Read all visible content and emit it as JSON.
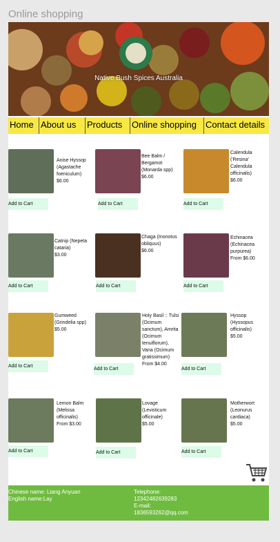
{
  "page_title": "Online shopping",
  "banner": {
    "caption": "Native Bush Spices Australia"
  },
  "nav": [
    {
      "label": "Home"
    },
    {
      "label": "About us"
    },
    {
      "label": "Products"
    },
    {
      "label": "Online shopping"
    },
    {
      "label": "Contact details"
    }
  ],
  "products": [
    {
      "name": "Anise Hyssop (Agastache foeniculum)",
      "price": "$6.00",
      "cart": "Add to Cart",
      "color": "#5e6e58"
    },
    {
      "name": "Bee Balm / Bergamot (Monarda spp)",
      "price": "$6.00",
      "cart": "Add to Cart",
      "color": "#7a4452"
    },
    {
      "name": "Calendula ('Resina' Calendula officinalis)",
      "price": "$6.00",
      "cart": "Add to Cart",
      "color": "#c7892c"
    },
    {
      "name": "Catnip (Nepeta cataria)",
      "price": "$3.00",
      "cart": "Add to Cart",
      "color": "#6a7a62"
    },
    {
      "name": "Chaga (Inonotus obliquus)",
      "price": "$6.00",
      "cart": "Add to Cart",
      "color": "#4a3020"
    },
    {
      "name": "Echinacea (Echinacea purpurea)",
      "price": "From $6.00",
      "cart": "Add to Cart",
      "color": "#6b3a4a"
    },
    {
      "name": "Gumweed (Grindelia spp)",
      "price": "$5.00",
      "cart": "Add to Cart",
      "color": "#c9a23c"
    },
    {
      "name": "Holy Basil :: Tulsi (Ocimum sanctum), Amrita (Ocimum tenuiflorum), Vana (Ocimum gratissimum)",
      "price": "From $4.00",
      "cart": "Add to Cart",
      "color": "#7b8168"
    },
    {
      "name": "Hyssop (Hyssopus officinalis)",
      "price": "$5.00",
      "cart": "Add to Cart",
      "color": "#6d7a58"
    },
    {
      "name": "Lemon Balm (Melissa officinalis)",
      "price": "From $3.00",
      "cart": "Add to Cart",
      "color": "#6c7a5e"
    },
    {
      "name": "Lovage (Levisticum officinale)",
      "price": "$5.00",
      "cart": "Add to Cart",
      "color": "#5f7348"
    },
    {
      "name": "Motherwort (Leonurus cardiaca)",
      "price": "$5.00",
      "cart": "Add to Cart",
      "color": "#66754e"
    }
  ],
  "footer": {
    "chinese_name": "Chinese name: Liang Anyuan",
    "english_name": "English name:Lay",
    "telephone_label": "Telephone:",
    "telephone": "12342482639283",
    "email_label": "E-mail:",
    "email": "1836593262@qq.com"
  },
  "icons": {
    "cart": "shopping-cart-icon"
  },
  "colors": {
    "nav_bg": "#f8e843",
    "cart_btn_bg": "#dcfbe8",
    "footer_bg": "#6fbb3f"
  }
}
